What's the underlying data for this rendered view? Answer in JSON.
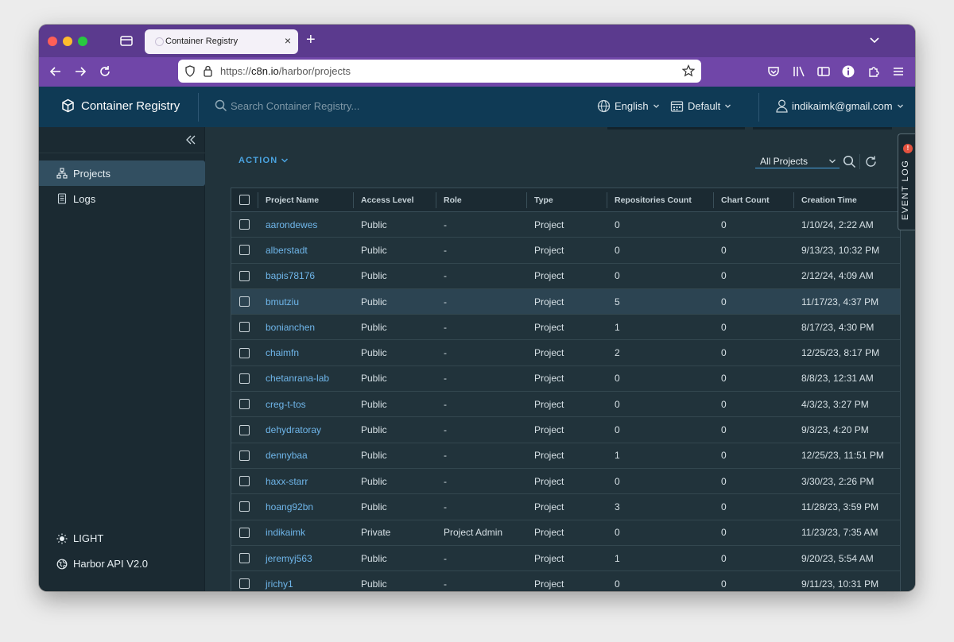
{
  "browser": {
    "tab_title": "Container Registry",
    "tab_close": "×",
    "new_tab": "+",
    "url_prefix": "https://",
    "url_host": "c8n.io",
    "url_path": "/harbor/projects"
  },
  "header": {
    "brand": "Container Registry",
    "search_placeholder": "Search Container Registry...",
    "language": "English",
    "calendar": "Default",
    "user": "indikaimk@gmail.com"
  },
  "sidebar": {
    "items": [
      {
        "label": "Projects",
        "icon": "projects-icon",
        "active": true
      },
      {
        "label": "Logs",
        "icon": "logs-icon",
        "active": false
      }
    ],
    "theme_label": "LIGHT",
    "api_label": "Harbor API V2.0"
  },
  "main": {
    "action_label": "ACTION",
    "filter_value": "All Projects"
  },
  "table": {
    "columns": [
      "Project Name",
      "Access Level",
      "Role",
      "Type",
      "Repositories Count",
      "Chart Count",
      "Creation Time"
    ],
    "rows": [
      [
        "aarondewes",
        "Public",
        "-",
        "Project",
        "0",
        "0",
        "1/10/24, 2:22 AM"
      ],
      [
        "alberstadt",
        "Public",
        "-",
        "Project",
        "0",
        "0",
        "9/13/23, 10:32 PM"
      ],
      [
        "bapis78176",
        "Public",
        "-",
        "Project",
        "0",
        "0",
        "2/12/24, 4:09 AM"
      ],
      [
        "bmutziu",
        "Public",
        "-",
        "Project",
        "5",
        "0",
        "11/17/23, 4:37 PM"
      ],
      [
        "bonianchen",
        "Public",
        "-",
        "Project",
        "1",
        "0",
        "8/17/23, 4:30 PM"
      ],
      [
        "chaimfn",
        "Public",
        "-",
        "Project",
        "2",
        "0",
        "12/25/23, 8:17 PM"
      ],
      [
        "chetanrana-lab",
        "Public",
        "-",
        "Project",
        "0",
        "0",
        "8/8/23, 12:31 AM"
      ],
      [
        "creg-t-tos",
        "Public",
        "-",
        "Project",
        "0",
        "0",
        "4/3/23, 3:27 PM"
      ],
      [
        "dehydratoray",
        "Public",
        "-",
        "Project",
        "0",
        "0",
        "9/3/23, 4:20 PM"
      ],
      [
        "dennybaa",
        "Public",
        "-",
        "Project",
        "1",
        "0",
        "12/25/23, 11:51 PM"
      ],
      [
        "haxx-starr",
        "Public",
        "-",
        "Project",
        "0",
        "0",
        "3/30/23, 2:26 PM"
      ],
      [
        "hoang92bn",
        "Public",
        "-",
        "Project",
        "3",
        "0",
        "11/28/23, 3:59 PM"
      ],
      [
        "indikaimk",
        "Private",
        "Project Admin",
        "Project",
        "0",
        "0",
        "11/23/23, 7:35 AM"
      ],
      [
        "jeremyj563",
        "Public",
        "-",
        "Project",
        "1",
        "0",
        "9/20/23, 5:54 AM"
      ],
      [
        "jrichy1",
        "Public",
        "-",
        "Project",
        "0",
        "0",
        "9/11/23, 10:31 PM"
      ]
    ],
    "highlighted_row": 3
  },
  "event_log": {
    "label": "EVENT LOG",
    "badge": "!"
  },
  "colors": {
    "tabstrip": "#5b3a8e",
    "toolbar": "#7046a8",
    "header": "#0f3a55",
    "sidebar": "#1b2a32",
    "main": "#21333b",
    "link": "#6fb6ea",
    "accent": "#4aa3e0"
  }
}
